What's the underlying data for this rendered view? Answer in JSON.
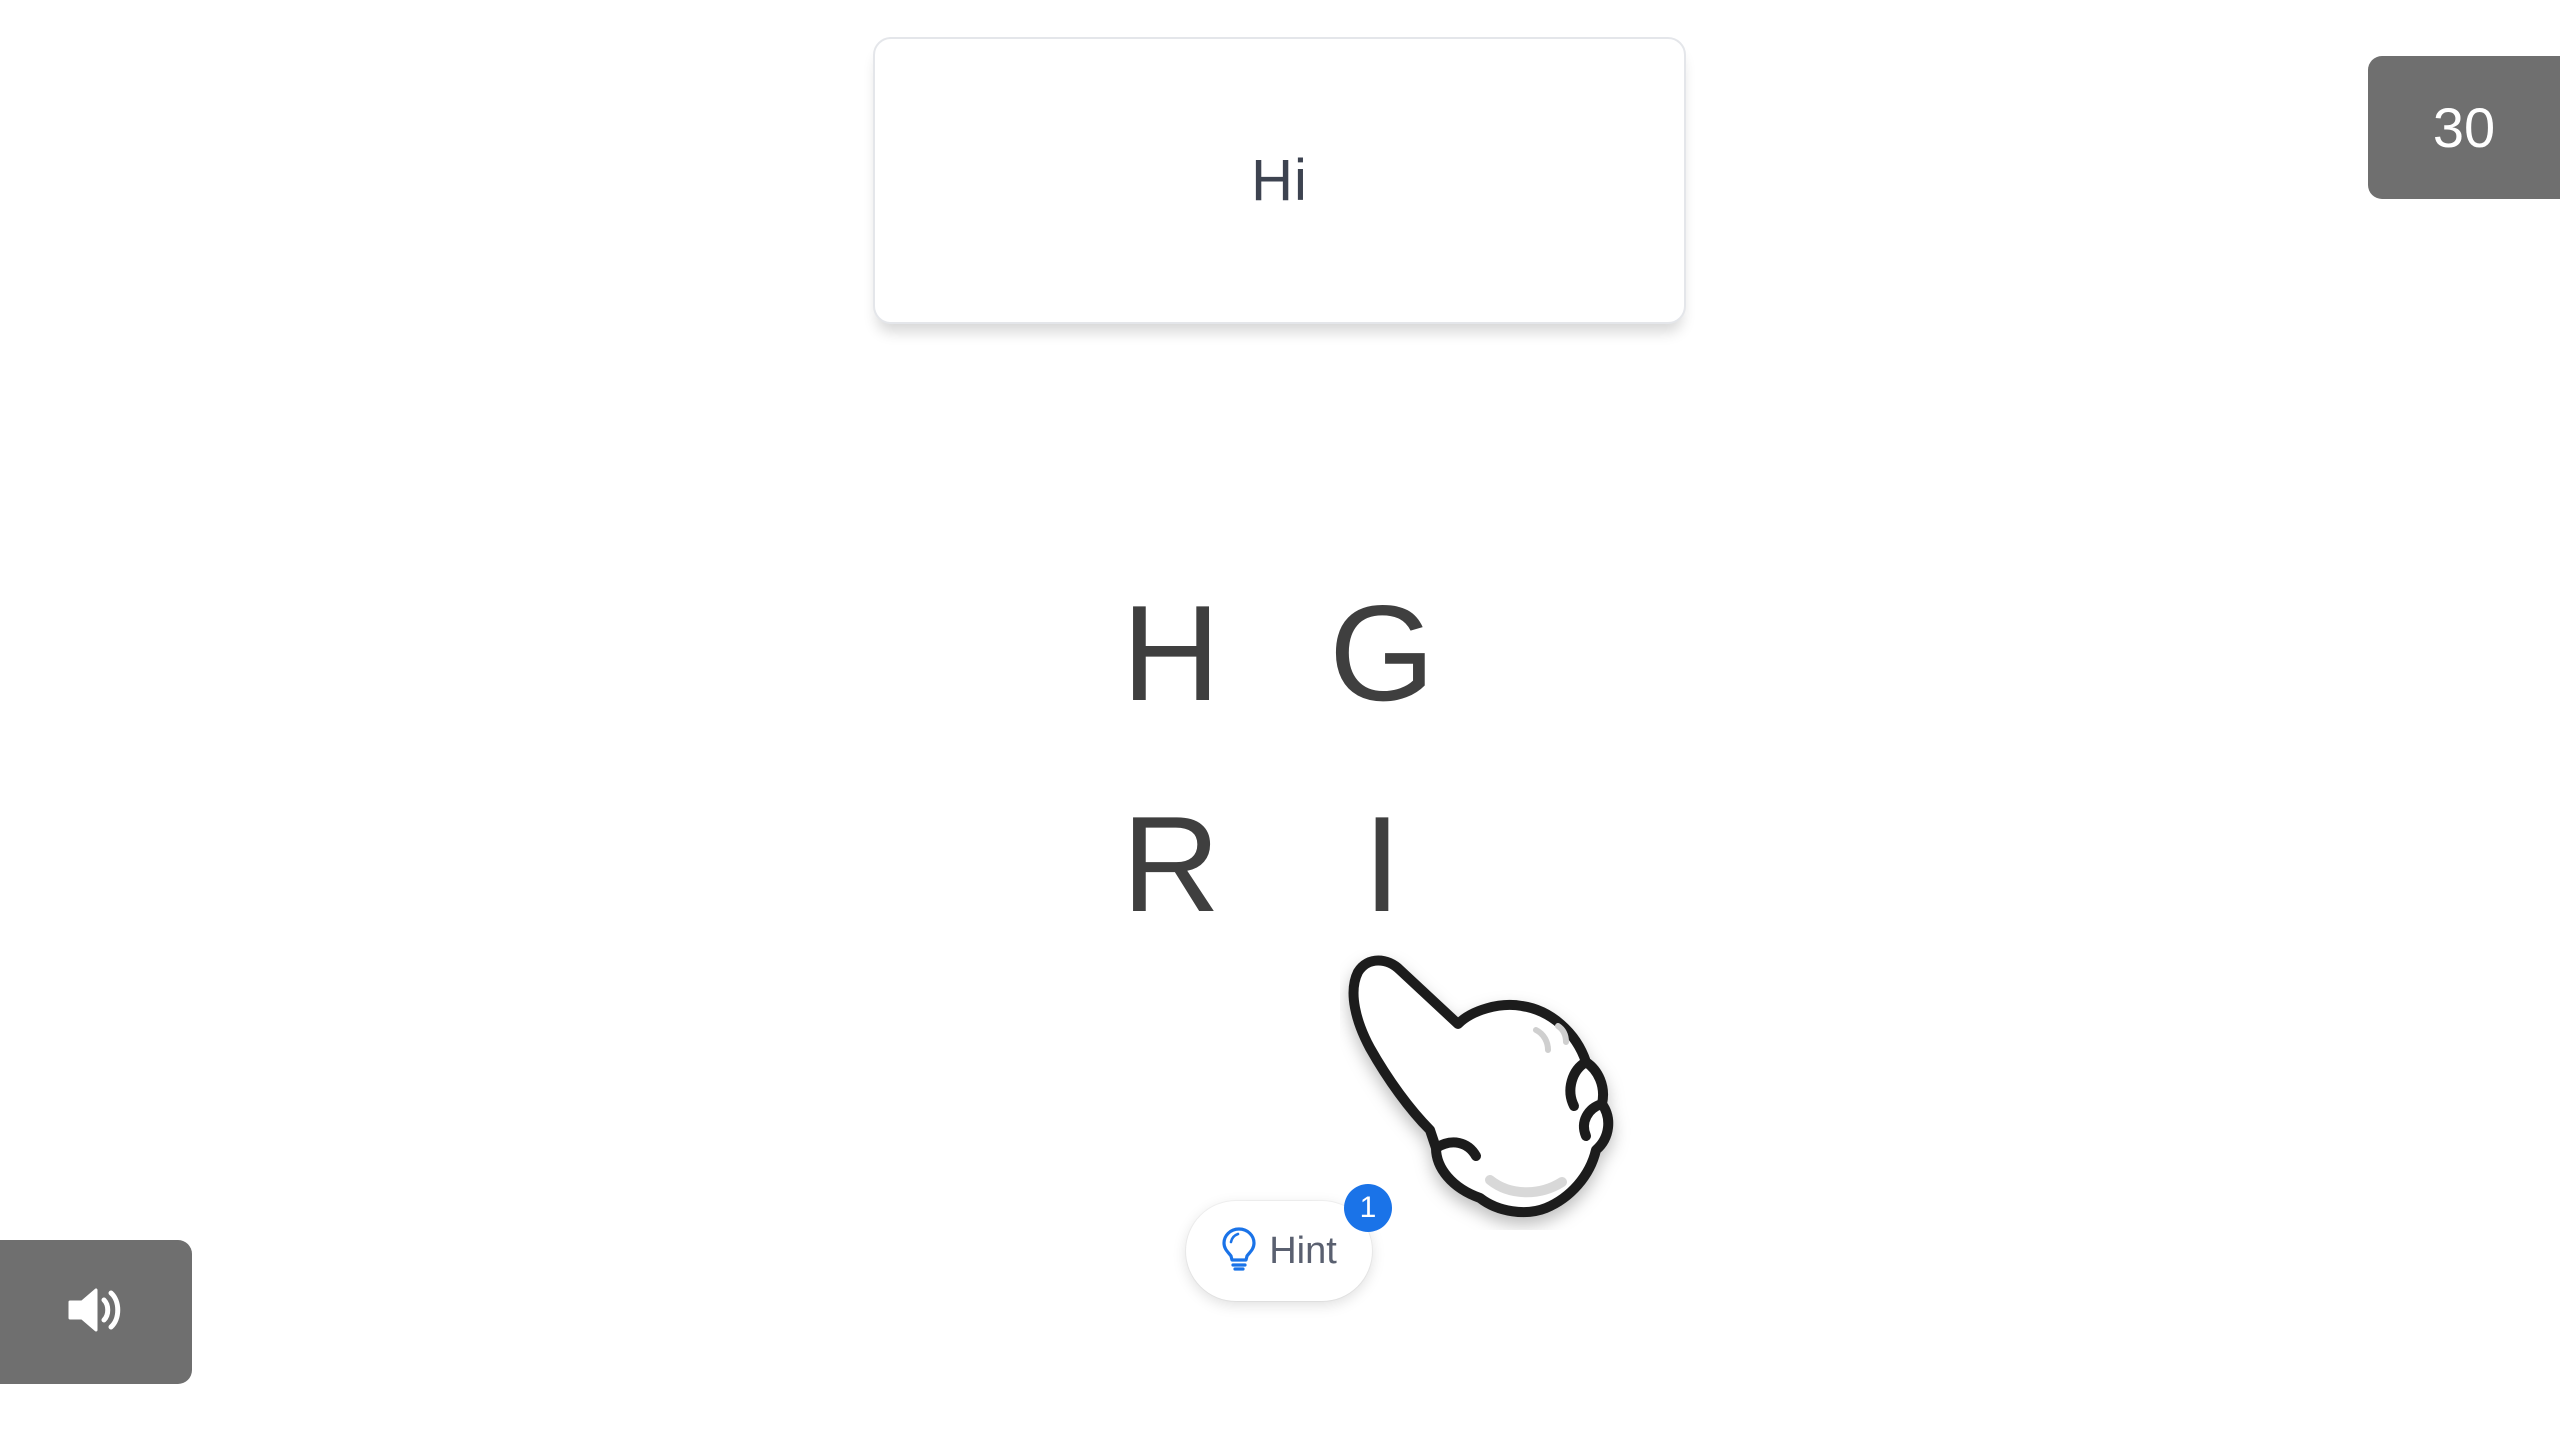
{
  "prompt": {
    "word": "Hi"
  },
  "timer": {
    "seconds": "30"
  },
  "tiles": {
    "t1": "H",
    "t2": "G",
    "t3": "R",
    "t4": "I"
  },
  "hint": {
    "label": "Hint",
    "count": "1",
    "icon": "lightbulb-icon"
  },
  "sound": {
    "icon": "speaker-icon"
  },
  "colors": {
    "panel_gray": "#6f6f6f",
    "badge_blue": "#1a73e8",
    "letter_dark": "#3f3f3f"
  }
}
